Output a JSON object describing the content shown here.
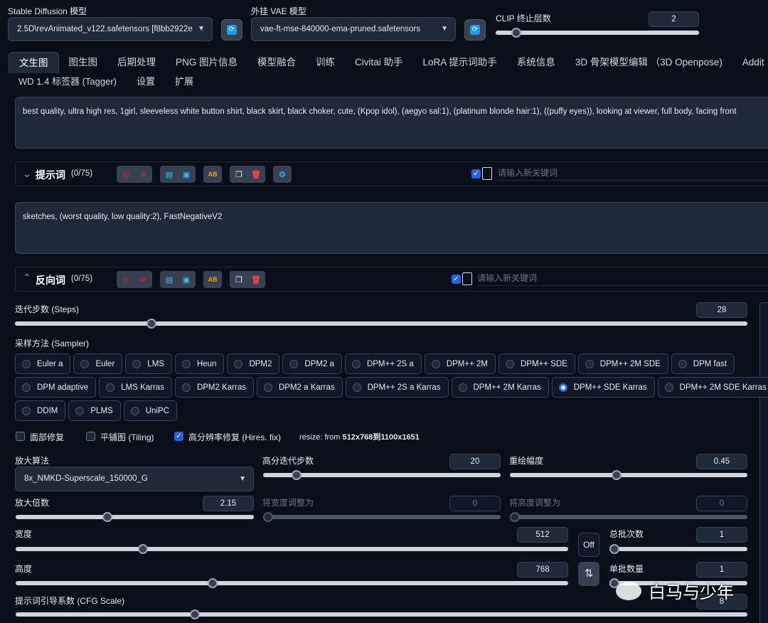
{
  "top": {
    "model_label": "Stable Diffusion 模型",
    "model_value": "2.5D\\revAnimated_v122.safetensors [f8bb2922e",
    "vae_label": "外挂 VAE 模型",
    "vae_value": "vae-ft-mse-840000-ema-pruned.safetensors",
    "clip_label": "CLIP 终止层数",
    "clip_value": "2",
    "clip_slider": 0.1
  },
  "tabs": [
    "文生图",
    "图生图",
    "后期处理",
    "PNG 图片信息",
    "模型融合",
    "训练",
    "Civitai 助手",
    "LoRA 提示词助手",
    "系统信息",
    "3D 骨架模型编辑 （3D Openpose)",
    "Addit"
  ],
  "tabs2": [
    "WD 1.4 标签器 (Tagger)",
    "设置",
    "扩展"
  ],
  "prompt": {
    "text": "best quality, ultra high res, 1girl, sleeveless white button shirt, black skirt, black choker, cute, (Kpop idol), (aegyo sal:1), (platinum blonde hair:1), ((puffy eyes)), looking at viewer, full body, facing front",
    "label": "提示词",
    "count": "(0/75)",
    "search_placeholder": "请输入新关键词"
  },
  "negative": {
    "text": "sketches, (worst quality, low quality:2), FastNegativeV2",
    "label": "反向词",
    "count": "(0/75)",
    "search_placeholder": "请输入新关键词"
  },
  "steps": {
    "label": "迭代步数 (Steps)",
    "value": "28",
    "fraction": 0.186
  },
  "sampler": {
    "label": "采样方法 (Sampler)",
    "selected": "DPM++ SDE Karras",
    "row1": [
      "Euler a",
      "Euler",
      "LMS",
      "Heun",
      "DPM2",
      "DPM2 a",
      "DPM++ 2S a",
      "DPM++ 2M",
      "DPM++ SDE",
      "DPM++ 2M SDE",
      "DPM fast"
    ],
    "row2": [
      "DPM adaptive",
      "LMS Karras",
      "DPM2 Karras",
      "DPM2 a Karras",
      "DPM++ 2S a Karras",
      "DPM++ 2M Karras",
      "DPM++ SDE Karras",
      "DPM++ 2M SDE Karras"
    ],
    "row3": [
      "DDIM",
      "PLMS",
      "UniPC"
    ]
  },
  "options": {
    "face": "面部修复",
    "tiling": "平铺图 (Tiling)",
    "hires": "高分辨率修复 (Hires. fix)",
    "resize_prefix": "resize: from ",
    "resize_value": "512x768到1100x1651"
  },
  "hires": {
    "upscaler_label": "放大算法",
    "upscaler_value": "8x_NMKD-Superscale_150000_G",
    "hires_steps_label": "高分迭代步数",
    "hires_steps_value": "20",
    "denoise_label": "重绘幅度",
    "denoise_value": "0.45",
    "scale_label": "放大倍数",
    "scale_value": "2.15",
    "resize_w_label": "将宽度调整为",
    "resize_w_value": "0",
    "resize_h_label": "将高度调整为",
    "resize_h_value": "0"
  },
  "size": {
    "width_label": "宽度",
    "width_value": "512",
    "height_label": "高度",
    "height_value": "768",
    "off_label": "Off",
    "swap_icon": "⇅",
    "batch_count_label": "总批次数",
    "batch_count_value": "1",
    "batch_size_label": "单批数量",
    "batch_size_value": "1"
  },
  "cfg": {
    "label": "提示词引导系数 (CFG Scale)",
    "value": "8"
  },
  "watermark": "白马与少年",
  "colors": {
    "accent": "#2563eb",
    "bg": "#0b0f19",
    "panel": "#1f2937"
  }
}
